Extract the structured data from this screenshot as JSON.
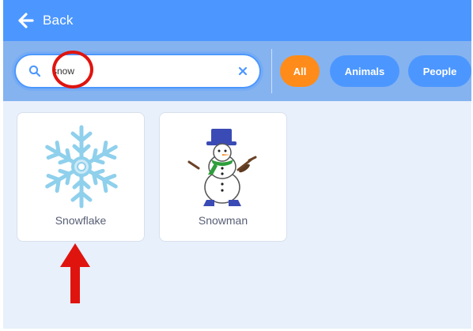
{
  "header": {
    "back_label": "Back",
    "back_icon": "arrow-left-icon"
  },
  "search": {
    "value": "snow",
    "placeholder": "",
    "icon": "search-icon",
    "clear_icon": "close-icon"
  },
  "categories": [
    {
      "label": "All",
      "selected": true,
      "color": "#ff8c1a"
    },
    {
      "label": "Animals",
      "selected": false,
      "color": "#4c97ff"
    },
    {
      "label": "People",
      "selected": false,
      "color": "#4c97ff"
    }
  ],
  "sprites": [
    {
      "name": "Snowflake",
      "icon": "snowflake-icon"
    },
    {
      "name": "Snowman",
      "icon": "snowman-icon"
    }
  ],
  "colors": {
    "header": "#4c97ff",
    "filter_bar": "#85b3f0",
    "background": "#e8f0fb",
    "annotation": "#e0140f"
  }
}
